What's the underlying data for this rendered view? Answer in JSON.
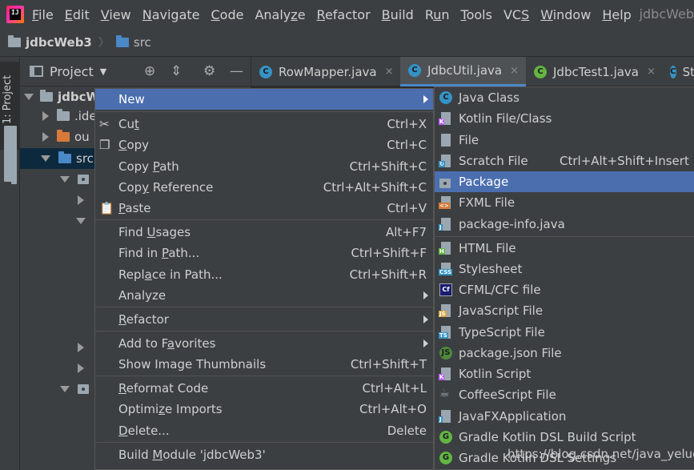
{
  "menubar": {
    "items": [
      {
        "pre": "",
        "u": "F",
        "post": "ile"
      },
      {
        "pre": "",
        "u": "E",
        "post": "dit"
      },
      {
        "pre": "",
        "u": "V",
        "post": "iew"
      },
      {
        "pre": "",
        "u": "N",
        "post": "avigate"
      },
      {
        "pre": "",
        "u": "C",
        "post": "ode"
      },
      {
        "pre": "Analy",
        "u": "z",
        "post": "e"
      },
      {
        "pre": "",
        "u": "R",
        "post": "efactor"
      },
      {
        "pre": "",
        "u": "B",
        "post": "uild"
      },
      {
        "pre": "R",
        "u": "u",
        "post": "n"
      },
      {
        "pre": "",
        "u": "T",
        "post": "ools"
      },
      {
        "pre": "VC",
        "u": "S",
        "post": ""
      },
      {
        "pre": "",
        "u": "W",
        "post": "indow"
      },
      {
        "pre": "",
        "u": "H",
        "post": "elp"
      }
    ],
    "window_title": "jdbcWeb"
  },
  "breadcrumb": {
    "project": "jdbcWeb3",
    "folder": "src"
  },
  "left_strip": {
    "tab_label": "1: Project"
  },
  "project_panel": {
    "title": "Project"
  },
  "tabs": [
    {
      "label": "RowMapper.java",
      "close": "×",
      "active": false
    },
    {
      "label": "JdbcUtil.java",
      "close": "×",
      "active": true
    },
    {
      "label": "JdbcTest1.java",
      "close": "×",
      "active": false
    },
    {
      "label": "St",
      "close": "",
      "active": false
    }
  ],
  "tree": {
    "root_label": "jdbcW",
    "idea_label": ".ide",
    "out_label": "ou",
    "src_label": "src"
  },
  "context_menu": {
    "new": "New",
    "cut": {
      "pre": "Cu",
      "u": "t",
      "post": "",
      "shortcut": "Ctrl+X"
    },
    "copy": {
      "pre": "",
      "u": "C",
      "post": "opy",
      "shortcut": "Ctrl+C"
    },
    "copy_path": {
      "pre": "Copy ",
      "u": "P",
      "post": "ath",
      "shortcut": "Ctrl+Shift+C"
    },
    "copy_reference": {
      "pre": "Cop",
      "u": "y",
      "post": " Reference",
      "shortcut": "Ctrl+Alt+Shift+C"
    },
    "paste": {
      "pre": "",
      "u": "P",
      "post": "aste",
      "shortcut": "Ctrl+V"
    },
    "find_usages": {
      "pre": "Find ",
      "u": "U",
      "post": "sages",
      "shortcut": "Alt+F7"
    },
    "find_in_path": {
      "pre": "Find in ",
      "u": "P",
      "post": "ath...",
      "shortcut": "Ctrl+Shift+F"
    },
    "replace_in_path": {
      "pre": "Repl",
      "u": "a",
      "post": "ce in Path...",
      "shortcut": "Ctrl+Shift+R"
    },
    "analyze": "Analyze",
    "refactor": {
      "pre": "",
      "u": "R",
      "post": "efactor"
    },
    "add_favorites": {
      "pre": "Add to F",
      "u": "a",
      "post": "vorites"
    },
    "show_thumbnails": {
      "label": "Show Image Thumbnails",
      "shortcut": "Ctrl+Shift+T"
    },
    "reformat": {
      "pre": "",
      "u": "R",
      "post": "eformat Code",
      "shortcut": "Ctrl+Alt+L"
    },
    "optimize": {
      "pre": "Optimi",
      "u": "z",
      "post": "e Imports",
      "shortcut": "Ctrl+Alt+O"
    },
    "delete": {
      "pre": "",
      "u": "D",
      "post": "elete...",
      "shortcut": "Delete"
    },
    "build_module": {
      "pre": "Build ",
      "u": "M",
      "post": "odule 'jdbcWeb3'"
    }
  },
  "submenu": {
    "items": [
      {
        "label": "Java Class",
        "icon": "java-class-icon",
        "glyph": "C"
      },
      {
        "label": "Kotlin File/Class",
        "icon": "kotlin-file-icon",
        "glyph": ""
      },
      {
        "label": "File",
        "icon": "file-icon",
        "glyph": ""
      },
      {
        "label": "Scratch File",
        "shortcut": "Ctrl+Alt+Shift+Insert",
        "icon": "scratch-file-icon",
        "glyph": ""
      },
      {
        "label": "Package",
        "icon": "package-icon",
        "glyph": ""
      },
      {
        "label": "FXML File",
        "icon": "fxml-file-icon",
        "glyph": "<>"
      },
      {
        "label": "package-info.java",
        "icon": "package-info-icon",
        "glyph": "J"
      },
      {
        "label": "HTML File",
        "icon": "html-file-icon",
        "glyph": "H"
      },
      {
        "label": "Stylesheet",
        "icon": "stylesheet-icon",
        "glyph": "CSS"
      },
      {
        "label": "CFML/CFC file",
        "icon": "cfml-file-icon",
        "glyph": "Cf"
      },
      {
        "label": "JavaScript File",
        "icon": "javascript-file-icon",
        "glyph": "JS"
      },
      {
        "label": "TypeScript File",
        "icon": "typescript-file-icon",
        "glyph": "TS"
      },
      {
        "label": "package.json File",
        "icon": "package-json-icon",
        "glyph": "JS"
      },
      {
        "label": "Kotlin Script",
        "icon": "kotlin-script-icon",
        "glyph": ""
      },
      {
        "label": "CoffeeScript File",
        "icon": "coffeescript-icon",
        "glyph": ""
      },
      {
        "label": "JavaFXApplication",
        "icon": "javafx-app-icon",
        "glyph": "J"
      },
      {
        "label": "Gradle Kotlin DSL Build Script",
        "icon": "gradle-icon",
        "glyph": "G"
      },
      {
        "label": "Gradle Kotlin DSL Settings",
        "icon": "gradle-icon",
        "glyph": "G"
      }
    ]
  },
  "watermark": "https://blog.csdn.net/java_yeluo"
}
